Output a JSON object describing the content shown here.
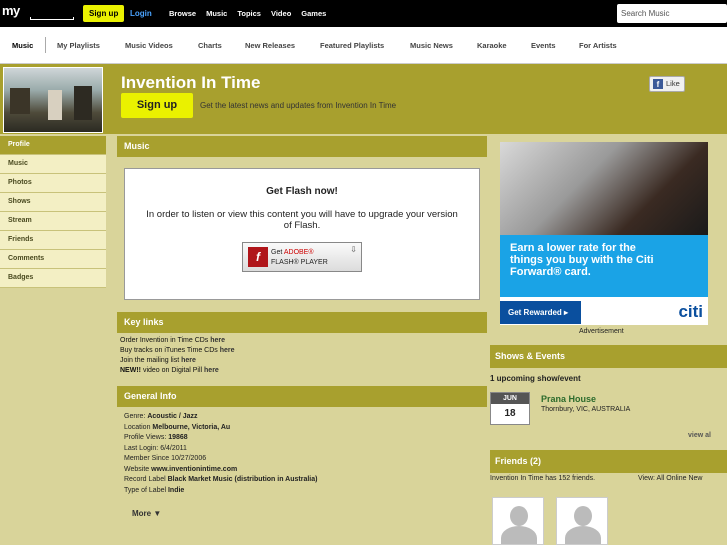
{
  "topbar": {
    "logo": "my",
    "signup": "Sign up",
    "login": "Login",
    "nav": [
      "Browse",
      "Music",
      "Topics",
      "Video",
      "Games"
    ],
    "search_placeholder": "Search Music"
  },
  "subnav": [
    "Music",
    "My Playlists",
    "Music Videos",
    "Charts",
    "New Releases",
    "Featured Playlists",
    "Music News",
    "Karaoke",
    "Events",
    "For Artists"
  ],
  "header": {
    "title": "Invention In Time",
    "signup": "Sign up",
    "tagline": "Get the latest news and updates from Invention In Time",
    "like": "Like"
  },
  "sidebar": [
    "Profile",
    "Music",
    "Photos",
    "Shows",
    "Stream",
    "Friends",
    "Comments",
    "Badges"
  ],
  "music": {
    "heading": "Music",
    "flash_title": "Get Flash now!",
    "flash_msg": "In order to listen or view this content you will have to upgrade your version of Flash.",
    "flash_btn_line1_prefix": "Get ",
    "flash_btn_adobe": "ADOBE®",
    "flash_btn_line2": "FLASH® PLAYER"
  },
  "key_links": {
    "heading": "Key links",
    "items": [
      {
        "text": "Order Invention in Time CDs ",
        "link": "here"
      },
      {
        "text": "Buy tracks on iTunes Time CDs ",
        "link": "here"
      },
      {
        "text": "Join the mailing list ",
        "link": "here"
      },
      {
        "prefix": "NEW!!",
        "text": " video on Digital Pill ",
        "link": "here"
      }
    ]
  },
  "general_info": {
    "heading": "General Info",
    "rows": [
      {
        "label": "Genre: ",
        "value": "Acoustic / Jazz"
      },
      {
        "label": "Location ",
        "value": "Melbourne, Victoria, Au"
      },
      {
        "label": "Profile Views: ",
        "value": "19868"
      },
      {
        "label": "Last Login: ",
        "value": "6/4/2011",
        "plain": true
      },
      {
        "label": "Member Since ",
        "value": "10/27/2006",
        "plain": true
      },
      {
        "label": "Website ",
        "value": "www.inventionintime.com"
      },
      {
        "label": "Record Label ",
        "value": "Black Market Music (distribution in Australia)"
      },
      {
        "label": "Type of Label ",
        "value": "Indie"
      }
    ],
    "more": "More ▼"
  },
  "ad": {
    "text": "Earn a lower rate for the things you buy with the Citi Forward® card.",
    "button": "Get Rewarded ▸",
    "brand": "citi",
    "label": "Advertisement"
  },
  "shows": {
    "heading": "Shows & Events",
    "upcoming": "1 upcoming show/event",
    "month": "JUN",
    "day": "18",
    "venue": "Prana House",
    "place": "Thornbury, VIC, AUSTRALIA",
    "view_all": "view al"
  },
  "friends": {
    "heading": "Friends (2)",
    "summary_prefix": "Invention In Time has ",
    "summary_count": "152",
    "summary_suffix": " friends.",
    "view": "View:  All  Online  New"
  },
  "colors": {
    "accent": "#a8a02e",
    "button": "#eaf100",
    "background": "#d9d49a"
  }
}
